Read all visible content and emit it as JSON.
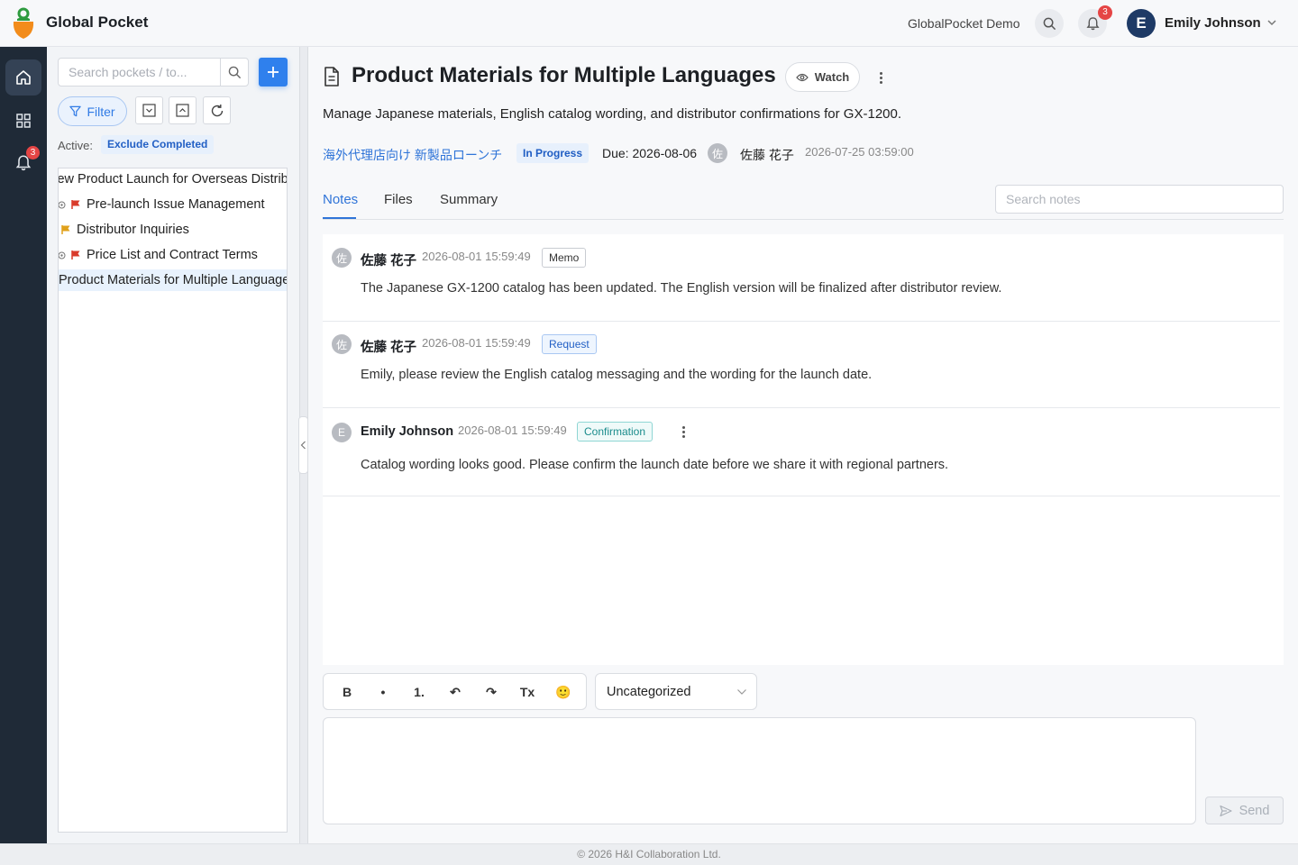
{
  "header": {
    "app_title": "Global Pocket",
    "org_name": "GlobalPocket Demo",
    "notification_count": "3",
    "user_initial": "E",
    "user_name": "Emily Johnson"
  },
  "rail": {
    "notification_count": "3",
    "items": [
      "home-icon",
      "grid-icon",
      "bell-icon"
    ]
  },
  "sidebar": {
    "search_placeholder": "Search pockets / to...",
    "filter_label": "Filter",
    "active_label": "Active:",
    "active_filter": "Exclude Completed",
    "tree": [
      {
        "label": "New Product Launch for Overseas Distributors",
        "flag": "none",
        "selected": false
      },
      {
        "label": "Pre-launch Issue Management",
        "flag": "red",
        "selected": false
      },
      {
        "label": "Distributor Inquiries",
        "flag": "yellow",
        "selected": false
      },
      {
        "label": "Price List and Contract Terms",
        "flag": "red",
        "selected": false
      },
      {
        "label": "Product Materials for Multiple Languages",
        "flag": "none",
        "selected": true
      }
    ]
  },
  "pocket": {
    "title": "Product Materials for Multiple Languages",
    "watch_label": "Watch",
    "description": "Manage Japanese materials, English catalog wording, and distributor confirmations for GX-1200.",
    "parent": "海外代理店向け 新製品ローンチ",
    "status": "In Progress",
    "due": "Due: 2026-08-06",
    "assignee_initial": "佐",
    "assignee": "佐藤 花子",
    "created_at": "2026-07-25 03:59:00"
  },
  "tabs": [
    "Notes",
    "Files",
    "Summary"
  ],
  "notes_search_placeholder": "Search notes",
  "notes": [
    {
      "initial": "佐",
      "author": "佐藤 花子",
      "time": "2026-08-01 15:59:49",
      "tag": "Memo",
      "text": "The Japanese GX-1200 catalog has been updated. The English version will be finalized after distributor review."
    },
    {
      "initial": "佐",
      "author": "佐藤 花子",
      "time": "2026-08-01 15:59:49",
      "tag": "Request",
      "text": "Emily, please review the English catalog messaging and the wording for the launch date."
    },
    {
      "initial": "E",
      "author": "Emily Johnson",
      "time": "2026-08-01 15:59:49",
      "tag": "Confirmation",
      "text": "Catalog wording looks good. Please confirm the launch date before we share it with regional partners."
    }
  ],
  "composer": {
    "toolbar": {
      "bold": "B",
      "bullet": "•",
      "numbered": "1.",
      "undo": "↶",
      "redo": "↷",
      "clear": "Tx",
      "emoji": "🙂"
    },
    "category": "Uncategorized",
    "send_label": "Send"
  },
  "footer": "© 2026 H&I Collaboration Ltd.",
  "colors": {
    "accent": "#2f80ed",
    "rail": "#1f2a37",
    "badge": "#e54545",
    "flag_red": "#d93b2b",
    "flag_yellow": "#e0a11b"
  }
}
